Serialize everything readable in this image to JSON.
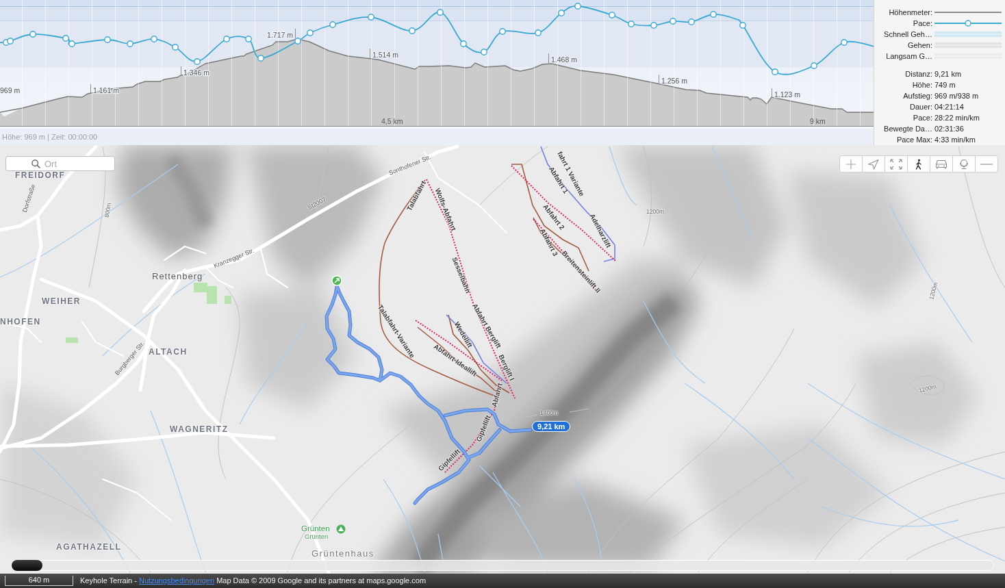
{
  "elevation_chart": {
    "elevation_labels": [
      "969 m",
      "1.161 m",
      "1.346 m",
      "1.717 m",
      "1.514 m",
      "1.468 m",
      "1.256 m",
      "1.123 m"
    ],
    "distance_labels": [
      "4,5 km",
      "9 km"
    ],
    "status": "Höhe: 969 m | Zeit: 00:00:00"
  },
  "legend": [
    {
      "label": "Höhenmeter:",
      "kind": "line",
      "color": "#8c8c8c"
    },
    {
      "label": "Pace:",
      "kind": "marker-line",
      "color": "#3ba9d0"
    },
    {
      "label": "Schnell Geh…",
      "kind": "band",
      "color": "#cfe7f1"
    },
    {
      "label": "Gehen:",
      "kind": "band",
      "color": "#e3e3e3"
    },
    {
      "label": "Langsam G…",
      "kind": "band",
      "color": "#ececec"
    }
  ],
  "stats": [
    {
      "label": "Distanz:",
      "value": "9,21 km"
    },
    {
      "label": "Höhe:",
      "value": "749 m"
    },
    {
      "label": "Aufstieg:",
      "value": "969 m/938 m"
    },
    {
      "label": "Dauer:",
      "value": "04:21:14"
    },
    {
      "label": "Pace:",
      "value": "28:22 min/km"
    },
    {
      "label": "Bewegte Da…",
      "value": "02:31:36"
    },
    {
      "label": "Pace Max:",
      "value": "4:33 min/km"
    }
  ],
  "map": {
    "search": {
      "placeholder": "Ort"
    },
    "labels": [
      {
        "text": "FREIDORF",
        "kind": "place"
      },
      {
        "text": "Sonthofener Str.",
        "kind": "street"
      },
      {
        "text": "fahrt 1 Variante",
        "kind": "piste"
      },
      {
        "text": "Talabfahrt",
        "kind": "piste"
      },
      {
        "text": "Wolfs-Abfahrt",
        "kind": "piste"
      },
      {
        "text": "Abfahrt 1",
        "kind": "piste"
      },
      {
        "text": "Dorfstraße",
        "kind": "street"
      },
      {
        "text": "St2007",
        "kind": "street"
      },
      {
        "text": "Abfahrt 2",
        "kind": "piste"
      },
      {
        "text": "Adelharzlift",
        "kind": "piste"
      },
      {
        "text": "Abfahrt 3",
        "kind": "piste"
      },
      {
        "text": "Breitensteinlift II",
        "kind": "piste"
      },
      {
        "text": "Kranzegger Str.",
        "kind": "street"
      },
      {
        "text": "Sesselbahn",
        "kind": "piste"
      },
      {
        "text": "Rettenberg",
        "kind": "town"
      },
      {
        "text": "WEIHER",
        "kind": "place"
      },
      {
        "text": "Abfahrt Berglift",
        "kind": "piste"
      },
      {
        "text": "NHOFEN",
        "kind": "place"
      },
      {
        "text": "Wedellift",
        "kind": "piste"
      },
      {
        "text": "Talabfahrt-Variante",
        "kind": "piste"
      },
      {
        "text": "ALTACH",
        "kind": "place"
      },
      {
        "text": "Burgberger Str.",
        "kind": "street"
      },
      {
        "text": "Abfahrt-Ideallift",
        "kind": "piste"
      },
      {
        "text": "Berglift I",
        "kind": "piste"
      },
      {
        "text": "Abfahrt",
        "kind": "piste"
      },
      {
        "text": "WAGNERITZ",
        "kind": "place"
      },
      {
        "text": "Gipfellift",
        "kind": "piste"
      },
      {
        "text": "Gipfellift",
        "kind": "piste"
      },
      {
        "text": "Grünten",
        "kind": "peak"
      },
      {
        "text": "Grünten",
        "kind": "peak-sub"
      },
      {
        "text": "AGATHAZELL",
        "kind": "place"
      },
      {
        "text": "Grüntenhaus",
        "kind": "hut"
      },
      {
        "text": "800m",
        "kind": "contour"
      },
      {
        "text": "1200m",
        "kind": "contour"
      },
      {
        "text": "1400m",
        "kind": "contour"
      },
      {
        "text": "1200m",
        "kind": "contour"
      },
      {
        "text": "1200m",
        "kind": "contour"
      }
    ],
    "distance_badge": "9,21 km",
    "timeline": {
      "level": 0
    }
  },
  "status_bar": {
    "scale": "640 m",
    "attribution": {
      "prefix": "Keyhole Terrain -",
      "link": "Nutzungsbedingungen",
      "suffix": "Map Data © 2009 Google and its partners at maps.google.com"
    }
  }
}
